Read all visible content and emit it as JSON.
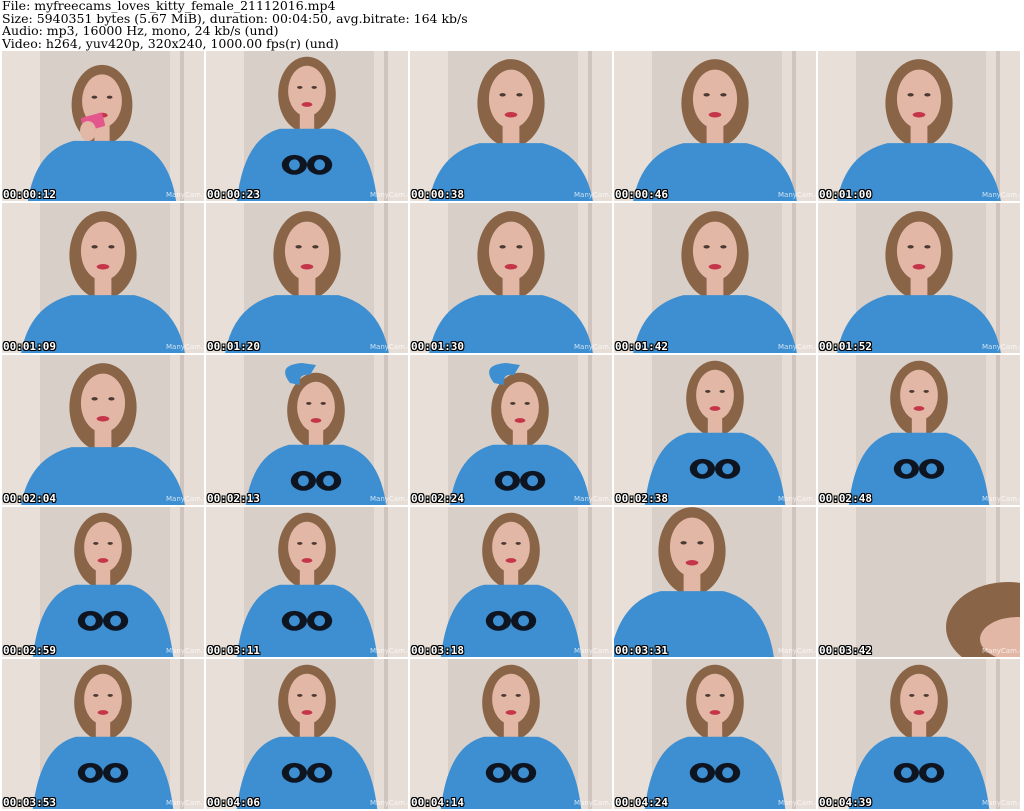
{
  "info": {
    "file_line": "File: myfreecams_loves_kitty_female_21112016.mp4",
    "size_line": "Size: 5940351 bytes (5.67 MiB), duration: 00:04:50, avg.bitrate: 164 kb/s",
    "audio_line": "Audio: mp3, 16000 Hz, mono, 24 kb/s (und)",
    "video_line": "Video: h264, yuv420p, 320x240, 1000.00 fps(r) (und)"
  },
  "colors": {
    "sweater": "#3d8fd1",
    "hair": "#8a6446",
    "skin": "#e2b7a6",
    "wall": "#d8cfc8",
    "curtain": "#ece3dc",
    "owl": "#0e1520"
  },
  "frames": [
    {
      "timestamp": "00:00:12",
      "variant": "lipstick"
    },
    {
      "timestamp": "00:00:23",
      "variant": "owl"
    },
    {
      "timestamp": "00:00:38",
      "variant": "close"
    },
    {
      "timestamp": "00:00:46",
      "variant": "close"
    },
    {
      "timestamp": "00:01:00",
      "variant": "close"
    },
    {
      "timestamp": "00:01:09",
      "variant": "close"
    },
    {
      "timestamp": "00:01:20",
      "variant": "close"
    },
    {
      "timestamp": "00:01:30",
      "variant": "close"
    },
    {
      "timestamp": "00:01:42",
      "variant": "close"
    },
    {
      "timestamp": "00:01:52",
      "variant": "close"
    },
    {
      "timestamp": "00:02:04",
      "variant": "close"
    },
    {
      "timestamp": "00:02:13",
      "variant": "arm-up"
    },
    {
      "timestamp": "00:02:24",
      "variant": "arm-up"
    },
    {
      "timestamp": "00:02:38",
      "variant": "owl"
    },
    {
      "timestamp": "00:02:48",
      "variant": "owl"
    },
    {
      "timestamp": "00:02:59",
      "variant": "owl"
    },
    {
      "timestamp": "00:03:11",
      "variant": "owl"
    },
    {
      "timestamp": "00:03:18",
      "variant": "owl"
    },
    {
      "timestamp": "00:03:31",
      "variant": "lean"
    },
    {
      "timestamp": "00:03:42",
      "variant": "edge"
    },
    {
      "timestamp": "00:03:53",
      "variant": "owl"
    },
    {
      "timestamp": "00:04:06",
      "variant": "owl"
    },
    {
      "timestamp": "00:04:14",
      "variant": "owl"
    },
    {
      "timestamp": "00:04:24",
      "variant": "owl"
    },
    {
      "timestamp": "00:04:39",
      "variant": "owl"
    }
  ]
}
